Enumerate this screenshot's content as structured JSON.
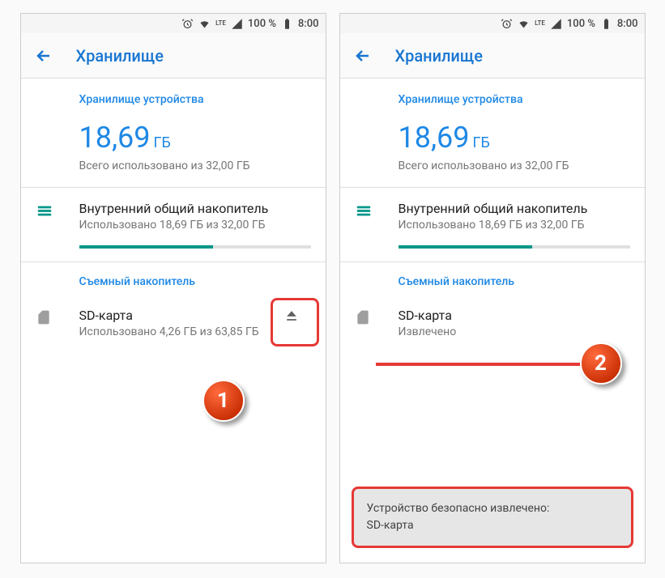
{
  "status": {
    "signal": "LTE",
    "battery": "100 %",
    "time": "8:00"
  },
  "header": {
    "title": "Хранилище"
  },
  "left": {
    "deviceStorage": {
      "header": "Хранилище устройства",
      "value": "18,69",
      "unit": "ГБ",
      "sub": "Всего использовано из 32,00 ГБ"
    },
    "internal": {
      "title": "Внутренний общий накопитель",
      "sub": "Использовано 18,69 ГБ из 32,00 ГБ"
    },
    "removable": {
      "header": "Съемный накопитель",
      "title": "SD-карта",
      "sub": "Использовано 4,26 ГБ из 63,85 ГБ"
    }
  },
  "right": {
    "deviceStorage": {
      "header": "Хранилище устройства",
      "value": "18,69",
      "unit": "ГБ",
      "sub": "Всего использовано из 32,00 ГБ"
    },
    "internal": {
      "title": "Внутренний общий накопитель",
      "sub": "Использовано 18,69 ГБ из 32,00 ГБ"
    },
    "removable": {
      "header": "Съемный накопитель",
      "title": "SD-карта",
      "sub": "Извлечено"
    },
    "toast": {
      "line1": "Устройство безопасно извлечено:",
      "line2": "SD-карта"
    }
  },
  "callouts": {
    "one": "1",
    "two": "2"
  }
}
